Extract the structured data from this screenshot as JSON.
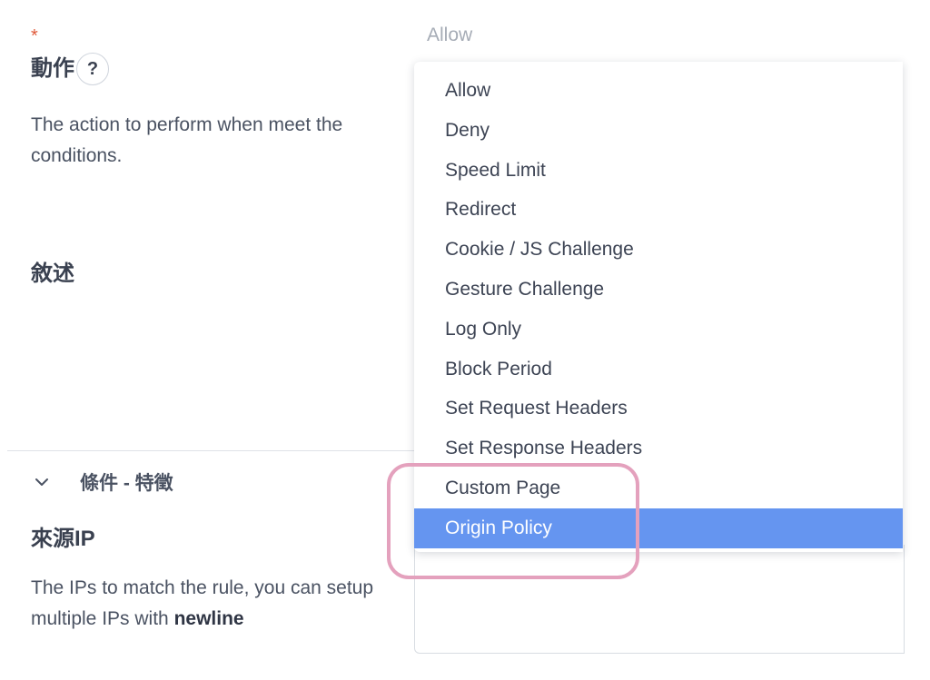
{
  "action_field": {
    "required_mark": "*",
    "label": "動作",
    "help_symbol": "?",
    "description": "The action to perform when meet the conditions.",
    "current_value": "Allow"
  },
  "action_options": [
    {
      "label": "Allow"
    },
    {
      "label": "Deny"
    },
    {
      "label": "Speed Limit"
    },
    {
      "label": "Redirect"
    },
    {
      "label": "Cookie / JS Challenge"
    },
    {
      "label": "Gesture Challenge"
    },
    {
      "label": "Log Only"
    },
    {
      "label": "Block Period"
    },
    {
      "label": "Set Request Headers"
    },
    {
      "label": "Set Response Headers"
    },
    {
      "label": "Custom Page"
    },
    {
      "label": "Origin Policy",
      "selected": true
    }
  ],
  "description_field": {
    "label": "敘述"
  },
  "conditions_section": {
    "title": "條件 - 特徵",
    "expanded": true
  },
  "source_ip_field": {
    "label": "來源IP",
    "description_prefix": "The IPs to match the rule, you can setup multiple IPs with ",
    "description_bold": "newline"
  },
  "icons": {
    "help": "question-circle-icon",
    "section_toggle": "chevron-down-icon"
  },
  "colors": {
    "selected_option_bg": "#6595f0",
    "required_mark": "#e05a3a",
    "highlight_ring": "#e4a1bd"
  }
}
